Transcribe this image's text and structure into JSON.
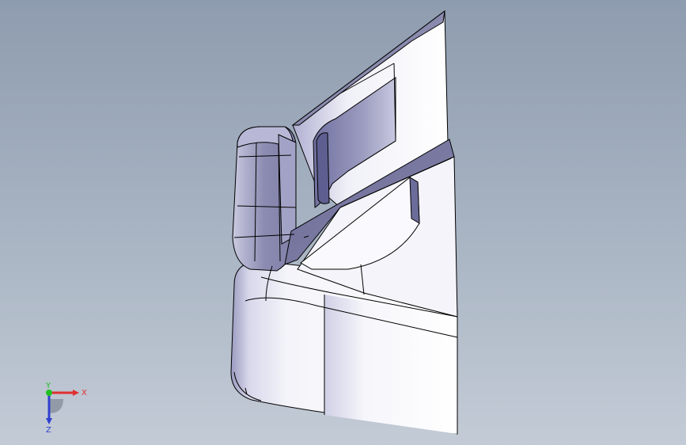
{
  "viewport": {
    "background_top": "#8e9caf",
    "background_bottom": "#c3cbd6"
  },
  "model": {
    "face_light": "#f5f5fb",
    "face_shadow": "#8a8ab0",
    "edge_color": "#000000"
  },
  "triad": {
    "x_label": "X",
    "y_label": "Y",
    "z_label": "Z",
    "x_color": "#e03030",
    "y_color": "#20c020",
    "z_color": "#3040d0"
  }
}
